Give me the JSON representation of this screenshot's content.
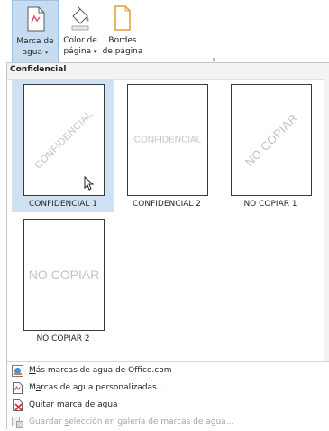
{
  "ribbon": {
    "watermark_btn": {
      "label_line1": "Marca de",
      "label_line2": "agua",
      "caret": "▾"
    },
    "page_color_btn": {
      "label_line1": "Color de",
      "label_line2": "página",
      "caret": "▾"
    },
    "page_borders_btn": {
      "label_line1": "Bordes",
      "label_line2": "de página"
    }
  },
  "gallery": {
    "section_title": "Confidencial",
    "items": [
      {
        "label": "CONFIDENCIAL 1",
        "watermark": "CONFIDENCIAL",
        "orientation": "diagonal",
        "selected": true
      },
      {
        "label": "CONFIDENCIAL 2",
        "watermark": "CONFIDENCIAL",
        "orientation": "horizontal",
        "selected": false
      },
      {
        "label": "NO COPIAR 1",
        "watermark": "NO COPIAR",
        "orientation": "diagonal",
        "selected": false
      },
      {
        "label": "NO COPIAR 2",
        "watermark": "NO COPIAR",
        "orientation": "horizontal",
        "selected": false
      }
    ]
  },
  "menu": {
    "items": [
      {
        "pre": "",
        "access": "M",
        "post": "ás marcas de agua de Office.com",
        "icon": "office-watermark-icon",
        "disabled": false
      },
      {
        "pre": "M",
        "access": "a",
        "post": "rcas de agua personalizadas...",
        "icon": "custom-watermark-icon",
        "disabled": false
      },
      {
        "pre": "Quita",
        "access": "r",
        "post": " marca de agua",
        "icon": "remove-watermark-icon",
        "disabled": false
      },
      {
        "pre": "Guardar ",
        "access": "s",
        "post": "elección en galería de marcas de agua...",
        "icon": "save-to-gallery-icon",
        "disabled": true
      }
    ]
  },
  "colors": {
    "selected_bg": "#cfe1f3",
    "active_button_bg": "#c5dcf1",
    "watermark_text": "#c4c4c4"
  }
}
